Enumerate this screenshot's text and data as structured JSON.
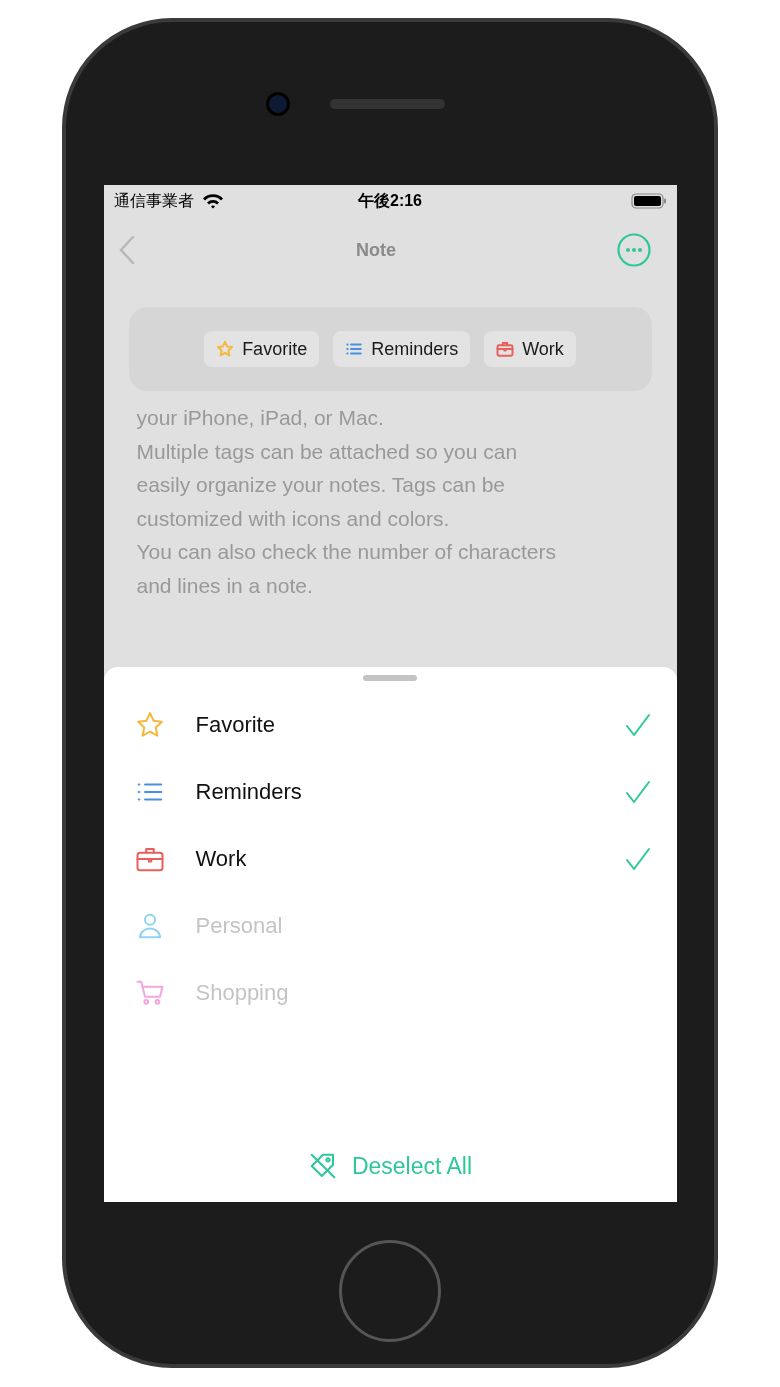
{
  "status_bar": {
    "carrier": "通信事業者",
    "time": "午後2:16"
  },
  "nav": {
    "title": "Note"
  },
  "note_lines": [
    "your iPhone, iPad, or Mac.",
    "Multiple tags can be attached so you can",
    "easily organize your notes. Tags can be",
    "customized with icons and colors.",
    "You can also check the number of characters",
    "and lines in a note."
  ],
  "attached_tags": [
    {
      "label": "Favorite",
      "kind": "star",
      "color": "#f5b83d"
    },
    {
      "label": "Reminders",
      "kind": "list",
      "color": "#4a90e2"
    },
    {
      "label": "Work",
      "kind": "briefcase",
      "color": "#e8605c"
    }
  ],
  "tags": [
    {
      "label": "Favorite",
      "kind": "star",
      "color": "#f5b83d",
      "checked": true
    },
    {
      "label": "Reminders",
      "kind": "list",
      "color": "#4a90e2",
      "checked": true
    },
    {
      "label": "Work",
      "kind": "briefcase",
      "color": "#e8605c",
      "checked": true
    },
    {
      "label": "Personal",
      "kind": "person",
      "color": "#8fd3f0",
      "checked": false
    },
    {
      "label": "Shopping",
      "kind": "cart",
      "color": "#f3a6e0",
      "checked": false
    }
  ],
  "deselect_button": "Deselect All"
}
